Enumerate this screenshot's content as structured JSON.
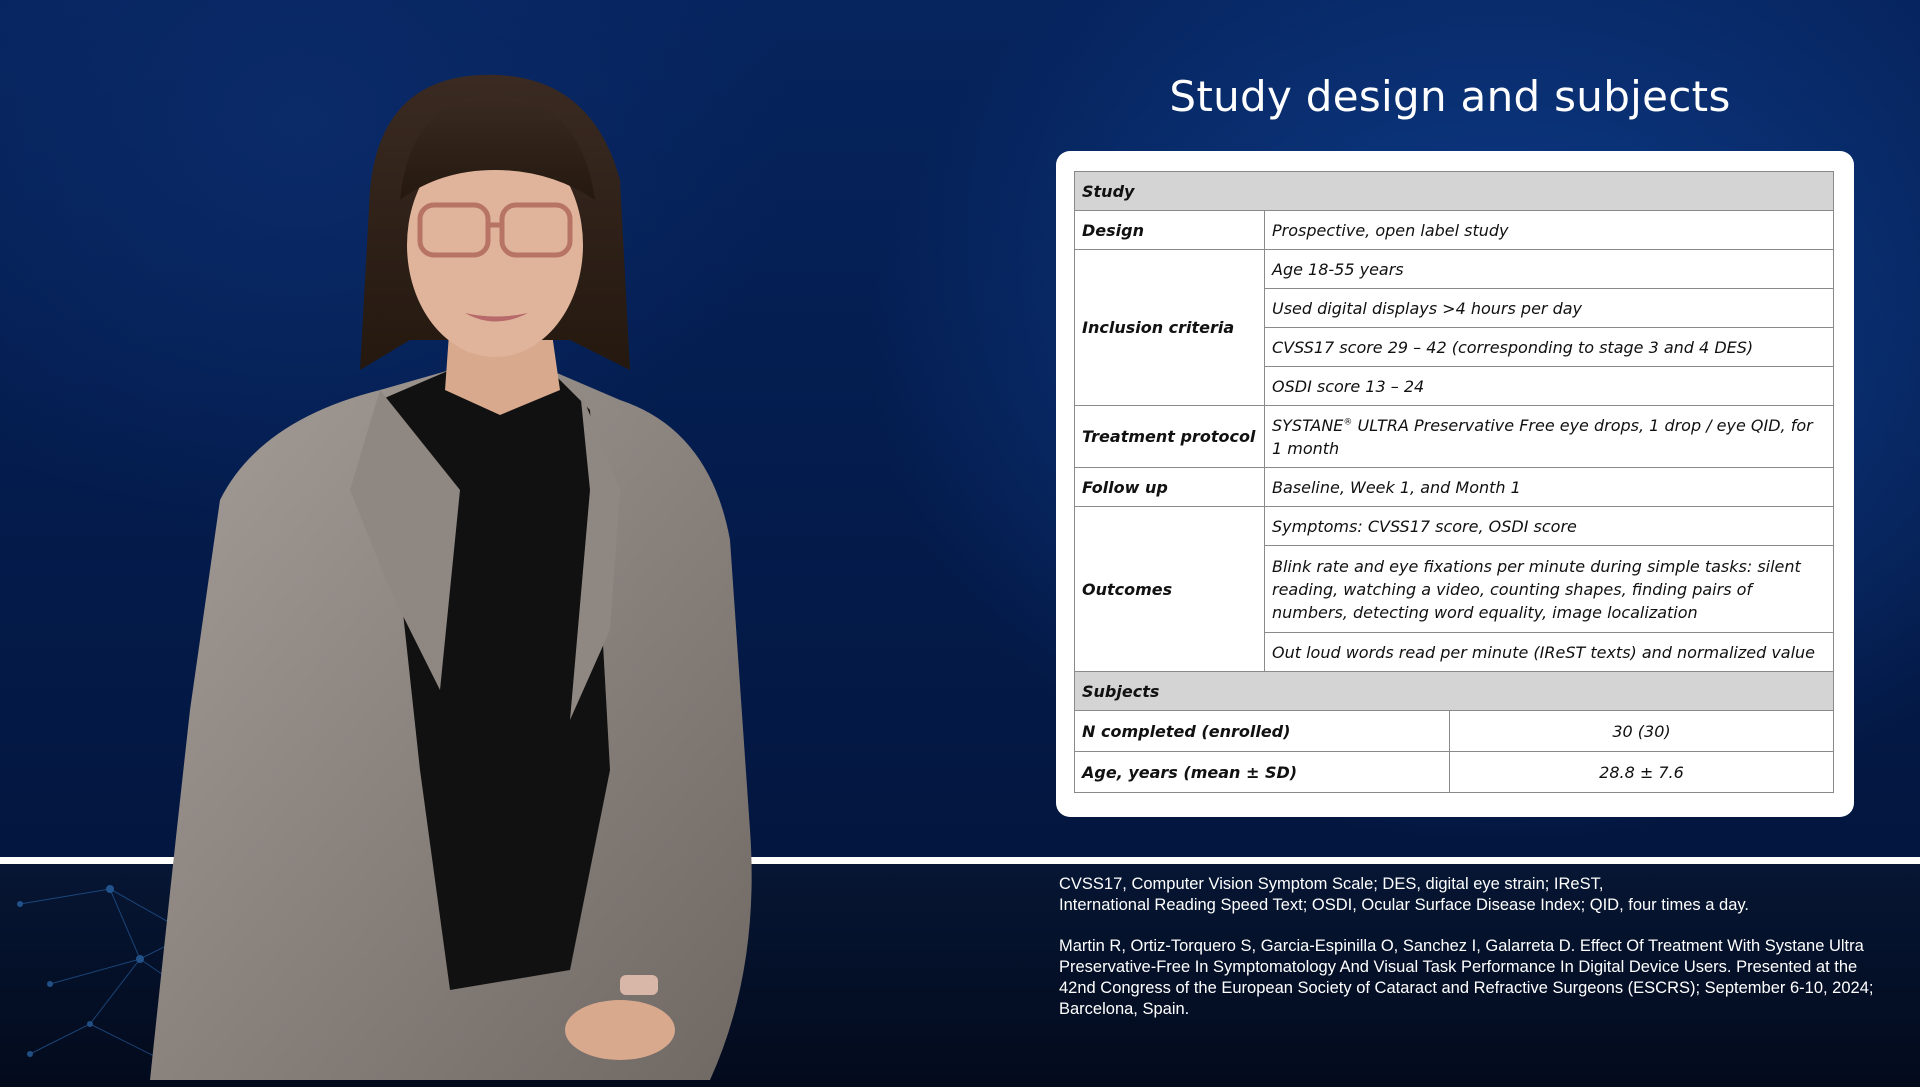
{
  "slide": {
    "title": "Study design and subjects"
  },
  "table": {
    "study_header": "Study",
    "design_label": "Design",
    "design_value": "Prospective, open label study",
    "inclusion_label": "Inclusion criteria",
    "inclusion_items": [
      "Age 18-55 years",
      "Used digital displays >4 hours per day",
      "CVSS17 score 29 – 42 (corresponding to stage 3 and 4 DES)",
      "OSDI score 13 – 24"
    ],
    "treatment_label": "Treatment protocol",
    "treatment_brand": "SYSTANE",
    "treatment_mark": "®",
    "treatment_value": " ULTRA Preservative Free eye drops, 1 drop / eye QID, for 1 month",
    "followup_label": "Follow up",
    "followup_value": "Baseline, Week 1, and Month 1",
    "outcomes_label": "Outcomes",
    "outcomes_items": [
      "Symptoms: CVSS17 score, OSDI score",
      "Blink rate and eye fixations per minute during simple tasks: silent reading, watching a video, counting shapes, finding pairs of numbers, detecting word equality, image localization",
      "Out loud words read per minute (IReST texts) and normalized value"
    ],
    "subjects_header": "Subjects",
    "n_label": "N completed (enrolled)",
    "n_value": "30 (30)",
    "age_label": "Age, years (mean ± SD)",
    "age_value": "28.8 ± 7.6"
  },
  "footnotes": {
    "abbreviations_line1": "CVSS17, Computer Vision Symptom Scale; DES, digital eye strain; IReST,",
    "abbreviations_line2": "International Reading Speed Text; OSDI, Ocular Surface Disease Index; QID, four times a day.",
    "reference": "Martin R, Ortiz-Torquero S, Garcia-Espinilla O, Sanchez I, Galarreta D. Effect Of Treatment With Systane Ultra Preservative-Free In Symptomatology And Visual Task Performance In Digital Device Users. Presented at the 42nd Congress of the European Society of Cataract and Refractive Surgeons (ESCRS); September 6-10, 2024; Barcelona, Spain."
  },
  "colors": {
    "background": "#041a4a",
    "table_header": "#d4d4d4",
    "text_light": "#ffffff"
  }
}
